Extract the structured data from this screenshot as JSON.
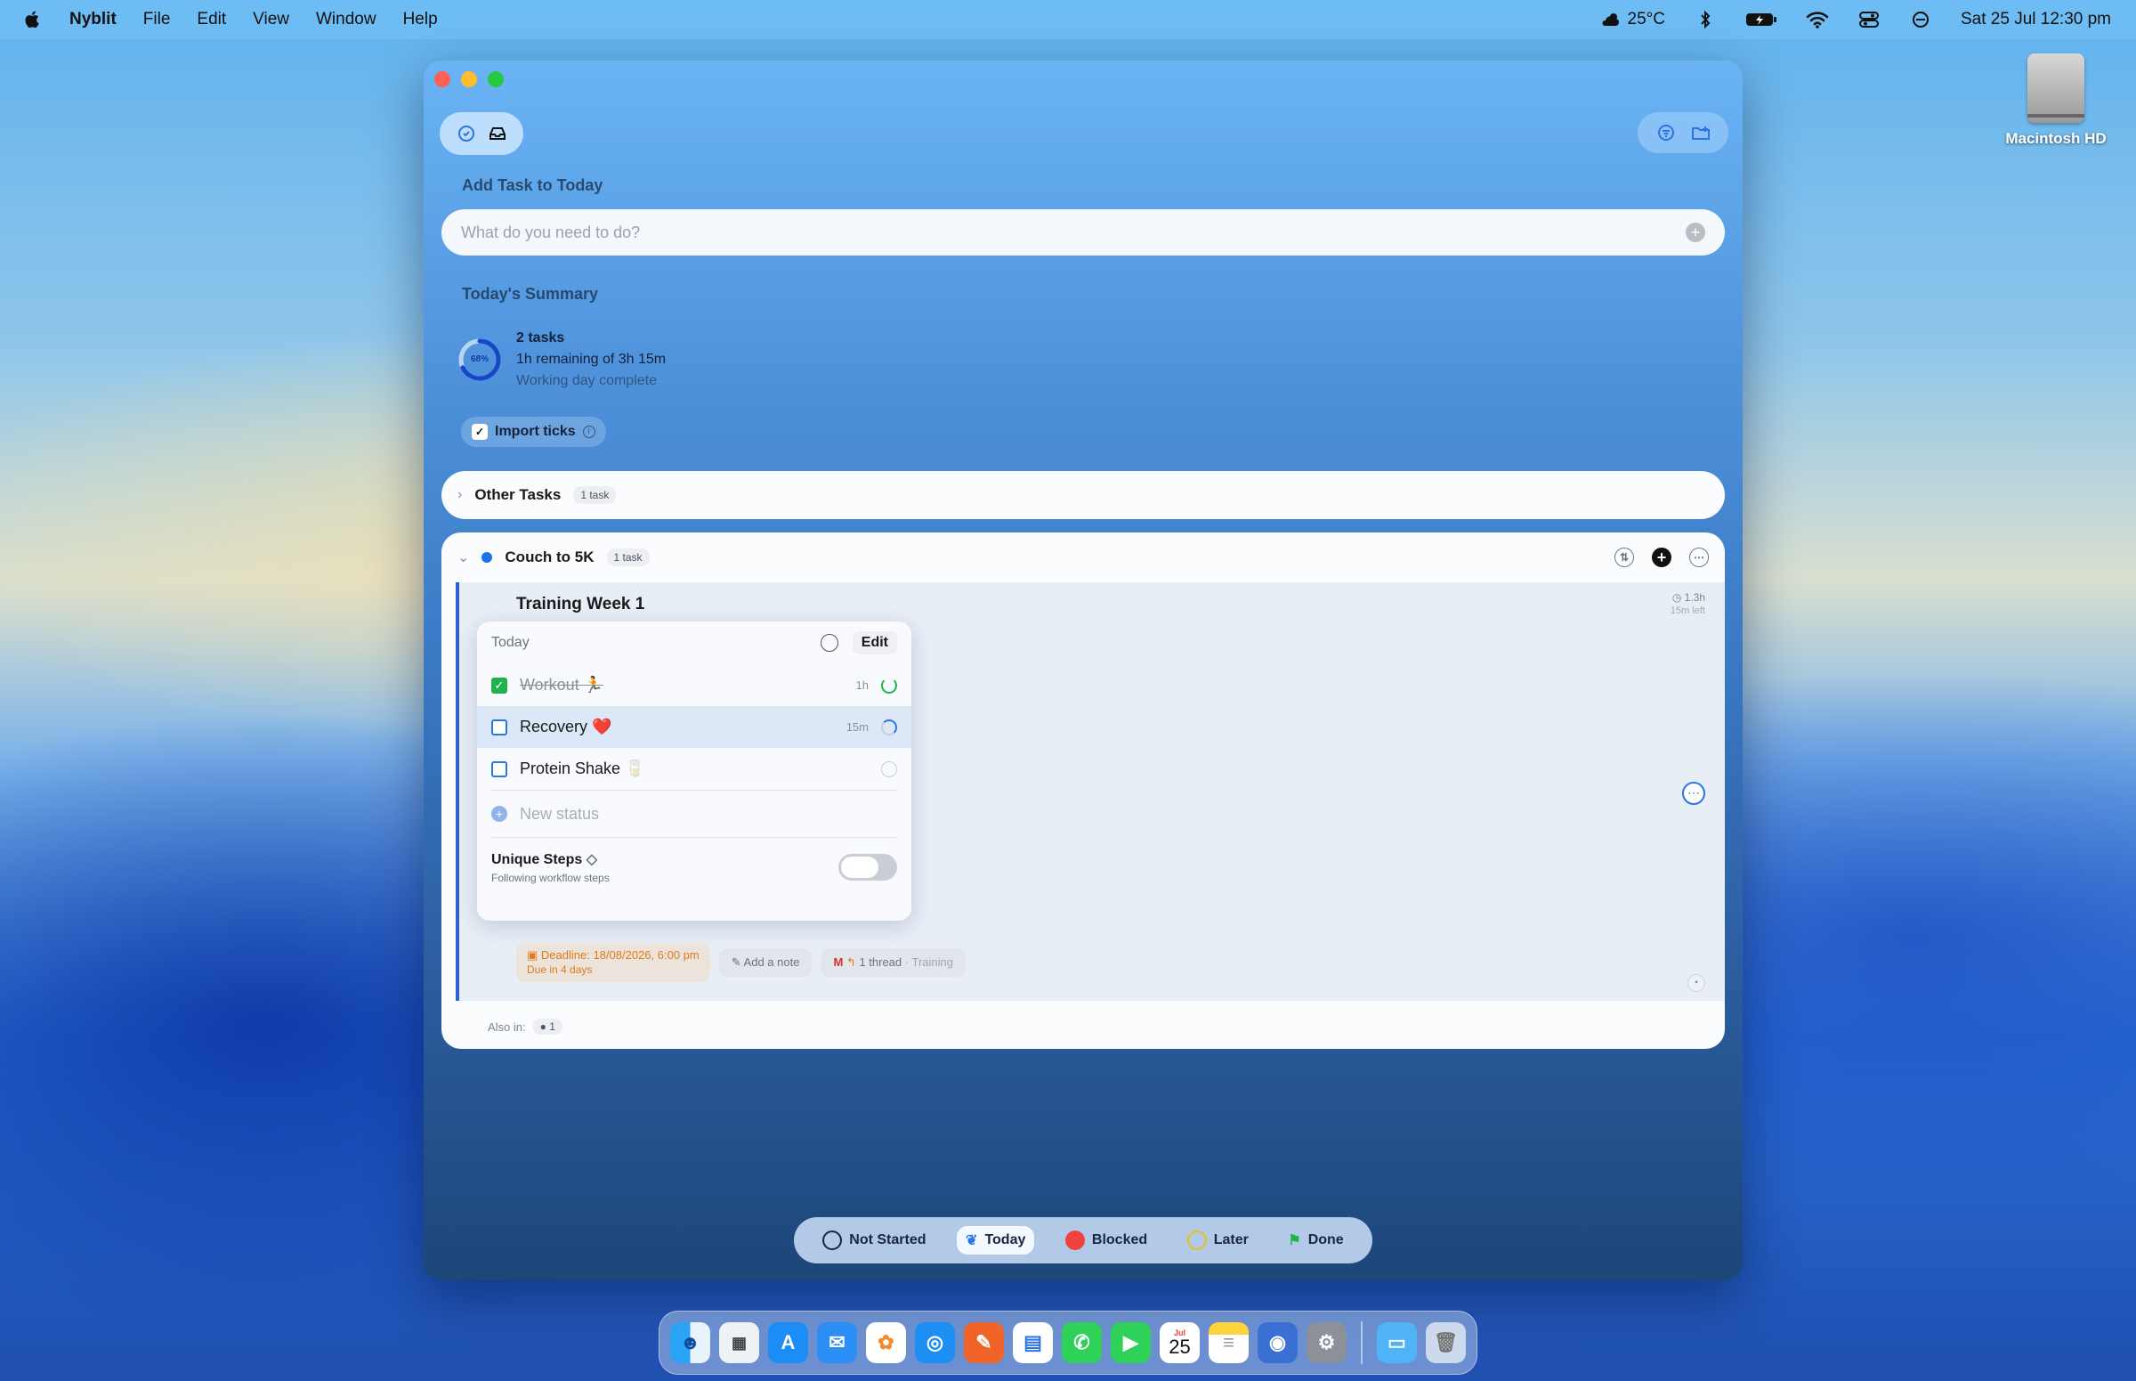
{
  "menubar": {
    "app_name": "Nyblit",
    "menus": [
      "File",
      "Edit",
      "View",
      "Window",
      "Help"
    ],
    "weather": "25°C",
    "datetime": "Sat 25 Jul  12:30 pm"
  },
  "desktop": {
    "drive_label": "Macintosh HD"
  },
  "window": {
    "add_task": {
      "title": "Add Task to Today",
      "placeholder": "What do you need to do?"
    },
    "summary": {
      "title": "Today's Summary",
      "progress_label": "68%",
      "progress": 0.68,
      "tasks": "2 tasks",
      "remaining": "1h remaining of 3h 15m",
      "status": "Working day complete"
    },
    "import": {
      "label": "Import ticks"
    },
    "other_tasks": {
      "label": "Other Tasks",
      "count": "1 task"
    },
    "project": {
      "name": "Couch to 5K",
      "count": "1 task",
      "task": {
        "title": "Training Week 1",
        "time_total": "1.3h",
        "time_left": "15m left",
        "popup": {
          "header": "Today",
          "edit": "Edit",
          "steps": [
            {
              "label": "Workout 🏃",
              "duration": "1h",
              "done": true
            },
            {
              "label": "Recovery ❤️",
              "duration": "15m",
              "done": false
            },
            {
              "label": "Protein Shake 🥛",
              "duration": "",
              "done": false
            }
          ],
          "new_status": "New status",
          "unique_title": "Unique Steps",
          "unique_sub": "Following workflow steps"
        },
        "deadline": "Deadline: 18/08/2026, 6:00 pm",
        "due": "Due in 4 days",
        "note": "Add a note",
        "thread": "1 thread",
        "thread_tag": "Training"
      },
      "also_in": "Also in:",
      "also_count": "1"
    },
    "status_bar": {
      "items": [
        "Not Started",
        "Today",
        "Blocked",
        "Later",
        "Done"
      ],
      "active": "Today"
    }
  },
  "dock": {
    "apps": [
      "Finder",
      "Launchpad",
      "App Store",
      "Mail",
      "Photos",
      "Safari",
      "Pages",
      "Nyblit",
      "Messages",
      "FaceTime",
      "Calendar",
      "Notes",
      "Script Editor",
      "System Settings"
    ],
    "calendar_month": "Jul",
    "calendar_day": "25",
    "extras": [
      "Downloads",
      "Trash"
    ]
  }
}
